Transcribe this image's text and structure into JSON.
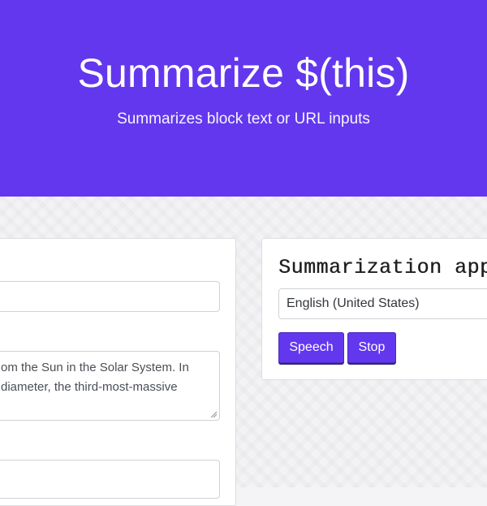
{
  "header": {
    "title": "Summarize $(this)",
    "subtitle": "Summarizes block text or URL inputs"
  },
  "input_card": {
    "url_input_value": "",
    "text_lines": [
      "om the Sun in the Solar System. In",
      "diameter, the third-most-massive"
    ],
    "bottom_input_value": ""
  },
  "summary_card": {
    "title": "Summarization app",
    "language_selected": "English (United States)",
    "speech_label": "Speech",
    "stop_label": "Stop"
  },
  "colors": {
    "brand": "#6337ee",
    "background": "#f3f3f6"
  }
}
